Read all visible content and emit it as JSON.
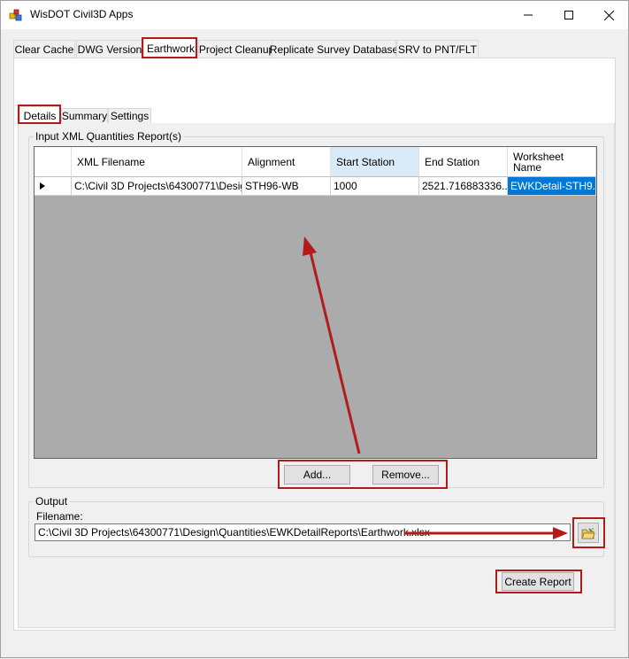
{
  "window": {
    "title": "WisDOT Civil3D Apps",
    "accent_color": "#b31b1b"
  },
  "main_tabs": [
    {
      "label": "Clear Cache",
      "active": false
    },
    {
      "label": "DWG Version",
      "active": false
    },
    {
      "label": "Earthwork",
      "active": true
    },
    {
      "label": "Project Cleanup",
      "active": false
    },
    {
      "label": "Replicate Survey Database",
      "active": false
    },
    {
      "label": "SRV to PNT/FLT",
      "active": false
    }
  ],
  "sub_tabs": [
    {
      "label": "Details",
      "active": true
    },
    {
      "label": "Summary",
      "active": false
    },
    {
      "label": "Settings",
      "active": false
    }
  ],
  "input_group": {
    "label": "Input XML Quantities Report(s)",
    "columns": [
      "XML Filename",
      "Alignment",
      "Start Station",
      "End Station",
      "Worksheet Name"
    ],
    "rows": [
      {
        "xml_filename": "C:\\Civil 3D Projects\\64300771\\Desig...",
        "alignment": "STH96-WB",
        "start_station": "1000",
        "end_station": "2521.716883336...",
        "worksheet_name": "EWKDetail-STH9..."
      }
    ],
    "add_label": "Add...",
    "remove_label": "Remove..."
  },
  "output_group": {
    "label": "Output",
    "filename_label": "Filename:",
    "filename_value": "C:\\Civil 3D Projects\\64300771\\Design\\Quantities\\EWKDetailReports\\Earthwork.xlsx",
    "browse_icon": "folder-browse-icon"
  },
  "create_report_label": "Create Report"
}
